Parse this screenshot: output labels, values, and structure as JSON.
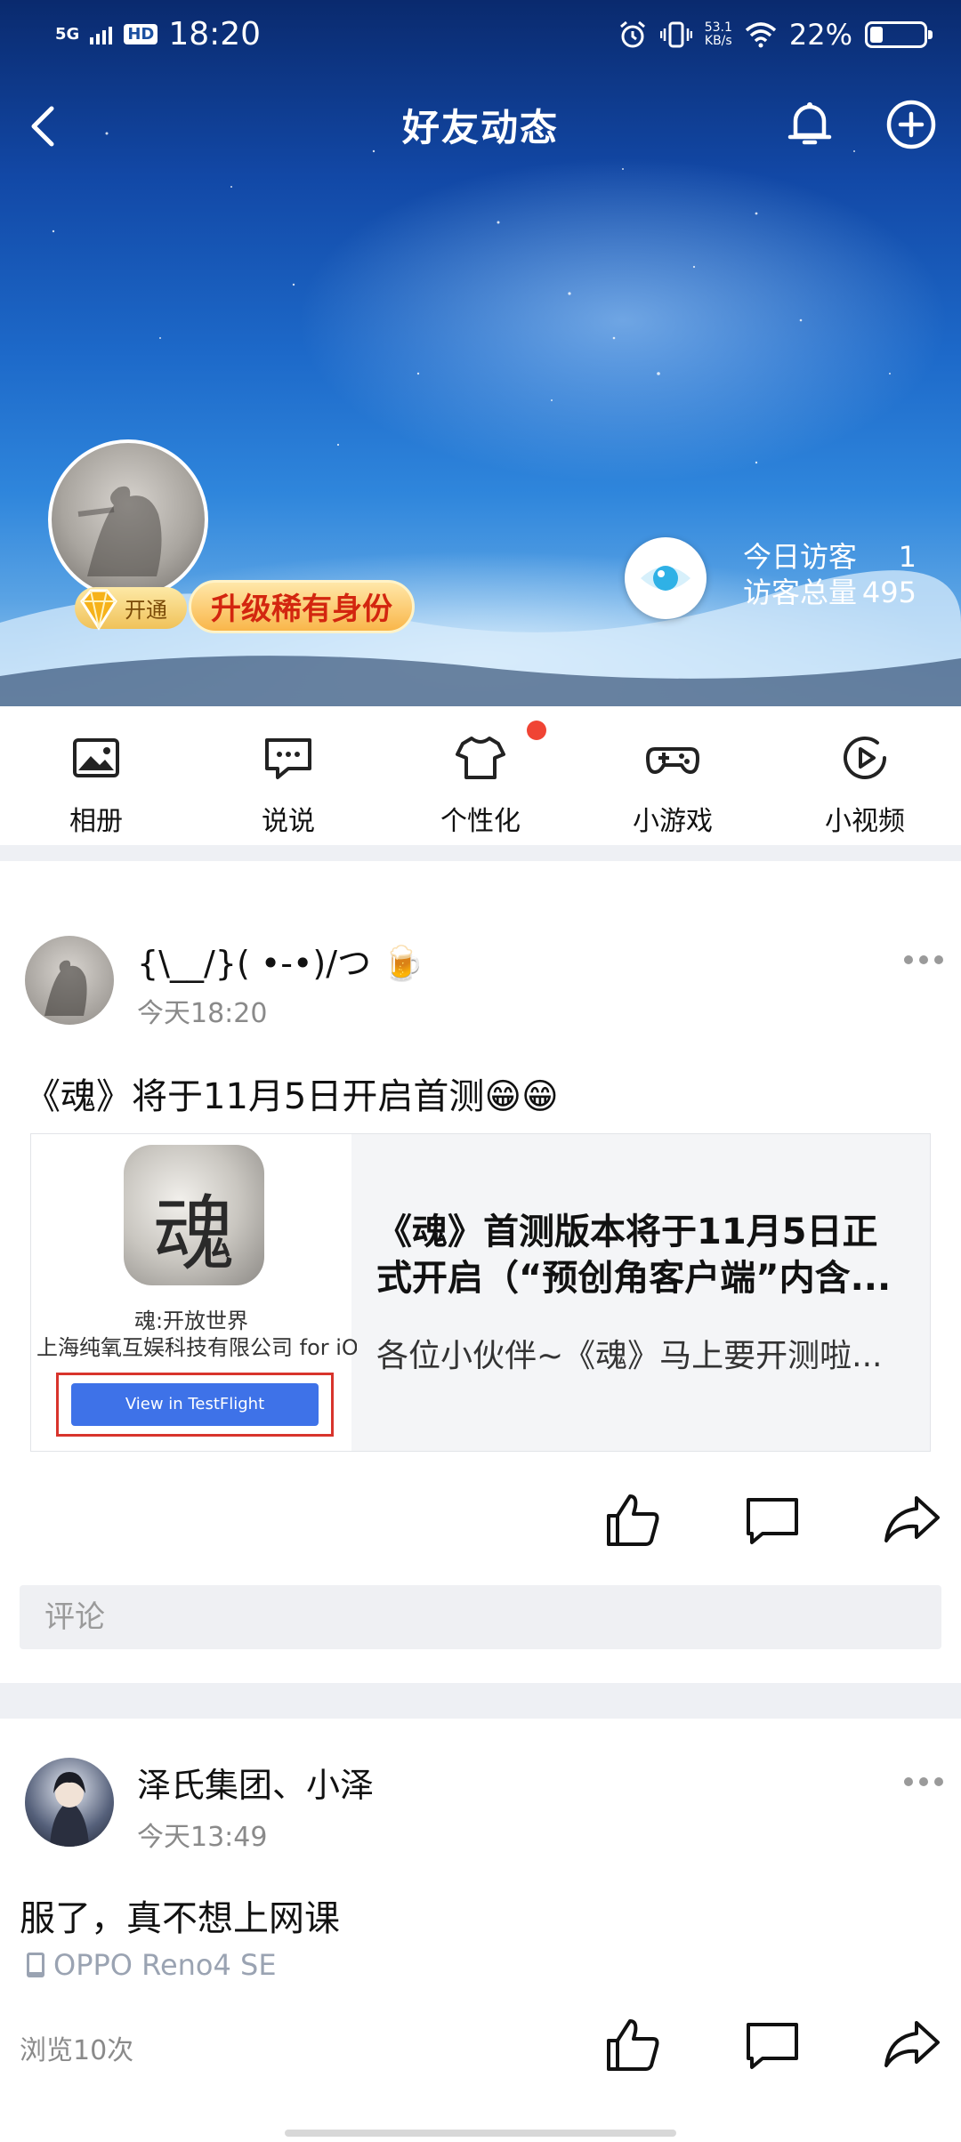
{
  "status_bar": {
    "network": "5G",
    "hd": "HD",
    "time": "18:20",
    "speed_value": "53.1",
    "speed_unit": "KB/s",
    "battery": "22%"
  },
  "nav": {
    "title": "好友动态"
  },
  "profile": {
    "vip_open_label": "开通",
    "upgrade_label": "升级稀有身份",
    "visitors_today_label": "今日访客",
    "visitors_today": "1",
    "visitors_total_label": "访客总量",
    "visitors_total": "495"
  },
  "quick_tabs": [
    {
      "label": "相册",
      "icon": "photo-album-icon"
    },
    {
      "label": "说说",
      "icon": "chat-bubble-icon"
    },
    {
      "label": "个性化",
      "icon": "tshirt-icon"
    },
    {
      "label": "小游戏",
      "icon": "gamepad-icon"
    },
    {
      "label": "小视频",
      "icon": "play-video-icon"
    }
  ],
  "post1": {
    "author": "{\\__/}( •-•)/つ 🍺",
    "time": "今天18:20",
    "text": "《魂》将于11月5日开启首测😁😁",
    "card": {
      "app_icon_char": "魂",
      "app_name": "魂:开放世界",
      "app_company": "上海纯氧互娱科技有限公司 for iOS",
      "testflight_button": "View in TestFlight",
      "title": "《魂》首测版本将于11月5日正式开启（“预创角客户端”内含...",
      "desc": "各位小伙伴~《魂》马上要开测啦..."
    },
    "comment_placeholder": "评论"
  },
  "post2": {
    "author": "泽氏集团、小泽",
    "time": "今天13:49",
    "text": "服了，真不想上网课",
    "device": "OPPO Reno4 SE",
    "views": "浏览10次"
  },
  "colors": {
    "accent_red": "#f04434",
    "testflight_blue": "#3e72e8",
    "upgrade_text": "#d3260f"
  }
}
